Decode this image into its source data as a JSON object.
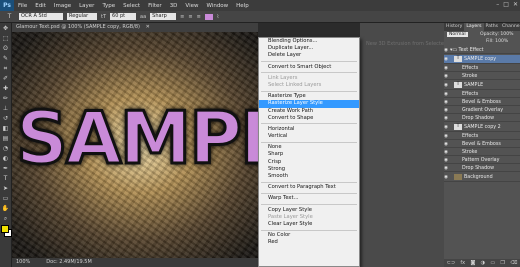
{
  "app": {
    "logo": "Ps"
  },
  "menubar": {
    "items": [
      "File",
      "Edit",
      "Image",
      "Layer",
      "Type",
      "Select",
      "Filter",
      "3D",
      "View",
      "Window",
      "Help"
    ]
  },
  "window_buttons": {
    "min": "–",
    "max": "□",
    "close": "✕"
  },
  "options_bar": {
    "font": "OCR A Std",
    "size": "60 pt",
    "aa_label": "aa",
    "aa_value": "Sharp",
    "label_regular": "Regular"
  },
  "document": {
    "tab_title": "Glamour Text.psd @ 100% (SAMPLE copy, RGB/8)",
    "canvas_text": "SAMPLE",
    "zoom": "100%",
    "doc_info": "Doc: 2.49M/19.5M"
  },
  "context_menu": {
    "items": [
      {
        "label": "Blending Options...",
        "state": "normal"
      },
      {
        "label": "Duplicate Layer...",
        "state": "normal"
      },
      {
        "label": "Delete Layer",
        "state": "normal"
      },
      {
        "sep": true
      },
      {
        "label": "Convert to Smart Object",
        "state": "normal"
      },
      {
        "sep": true
      },
      {
        "label": "Link Layers",
        "state": "disabled"
      },
      {
        "label": "Select Linked Layers",
        "state": "disabled"
      },
      {
        "sep": true
      },
      {
        "label": "Rasterize Type",
        "state": "normal"
      },
      {
        "label": "Rasterize Layer Style",
        "state": "selected"
      },
      {
        "label": "Create Work Path",
        "state": "normal"
      },
      {
        "label": "Convert to Shape",
        "state": "normal"
      },
      {
        "sep": true
      },
      {
        "label": "Horizontal",
        "state": "normal"
      },
      {
        "label": "Vertical",
        "state": "normal"
      },
      {
        "sep": true
      },
      {
        "label": "None",
        "state": "normal"
      },
      {
        "label": "Sharp",
        "state": "normal"
      },
      {
        "label": "Crisp",
        "state": "normal"
      },
      {
        "label": "Strong",
        "state": "normal"
      },
      {
        "label": "Smooth",
        "state": "normal"
      },
      {
        "sep": true
      },
      {
        "label": "Convert to Paragraph Text",
        "state": "normal"
      },
      {
        "sep": true
      },
      {
        "label": "Warp Text...",
        "state": "normal"
      },
      {
        "sep": true
      },
      {
        "label": "Copy Layer Style",
        "state": "normal"
      },
      {
        "label": "Paste Layer Style",
        "state": "disabled"
      },
      {
        "label": "Clear Layer Style",
        "state": "normal"
      },
      {
        "sep": true
      },
      {
        "label": "No Color",
        "state": "normal"
      },
      {
        "label": "Red",
        "state": "normal"
      }
    ],
    "hint": "New 3D Extrusion from Selected Layer"
  },
  "panels": {
    "tabs": [
      "History",
      "Layers",
      "Paths",
      "Channels"
    ],
    "active_tab": "Layers",
    "opacity_label": "Opacity:",
    "opacity_value": "100%",
    "fill_label": "Fill:",
    "fill_value": "100%",
    "layers": [
      {
        "name": "Text Effect",
        "kind": "group",
        "active": false
      },
      {
        "name": "SAMPLE copy",
        "kind": "text",
        "active": true
      },
      {
        "name": "Effects",
        "kind": "effect",
        "active": false
      },
      {
        "name": "Stroke",
        "kind": "effect",
        "active": false
      },
      {
        "name": "SAMPLE",
        "kind": "text",
        "active": false
      },
      {
        "name": "Effects",
        "kind": "effect",
        "active": false
      },
      {
        "name": "Bevel & Emboss",
        "kind": "effect",
        "active": false
      },
      {
        "name": "Gradient Overlay",
        "kind": "effect",
        "active": false
      },
      {
        "name": "Drop Shadow",
        "kind": "effect",
        "active": false
      },
      {
        "name": "SAMPLE copy 2",
        "kind": "text",
        "active": false
      },
      {
        "name": "Effects",
        "kind": "effect",
        "active": false
      },
      {
        "name": "Bevel & Emboss",
        "kind": "effect",
        "active": false
      },
      {
        "name": "Stroke",
        "kind": "effect",
        "active": false
      },
      {
        "name": "Pattern Overlay",
        "kind": "effect",
        "active": false
      },
      {
        "name": "Drop Shadow",
        "kind": "effect",
        "active": false
      },
      {
        "name": "Background",
        "kind": "bg",
        "active": false
      }
    ],
    "footer_icons": [
      "link-icon",
      "fx-icon",
      "mask-icon",
      "adjust-icon",
      "folder-icon",
      "new-layer-icon",
      "trash-icon"
    ]
  },
  "colors": {
    "accent_selected": "#3399ff",
    "layer_active": "#5a7aa8",
    "text_fill": "#c98ad8"
  }
}
